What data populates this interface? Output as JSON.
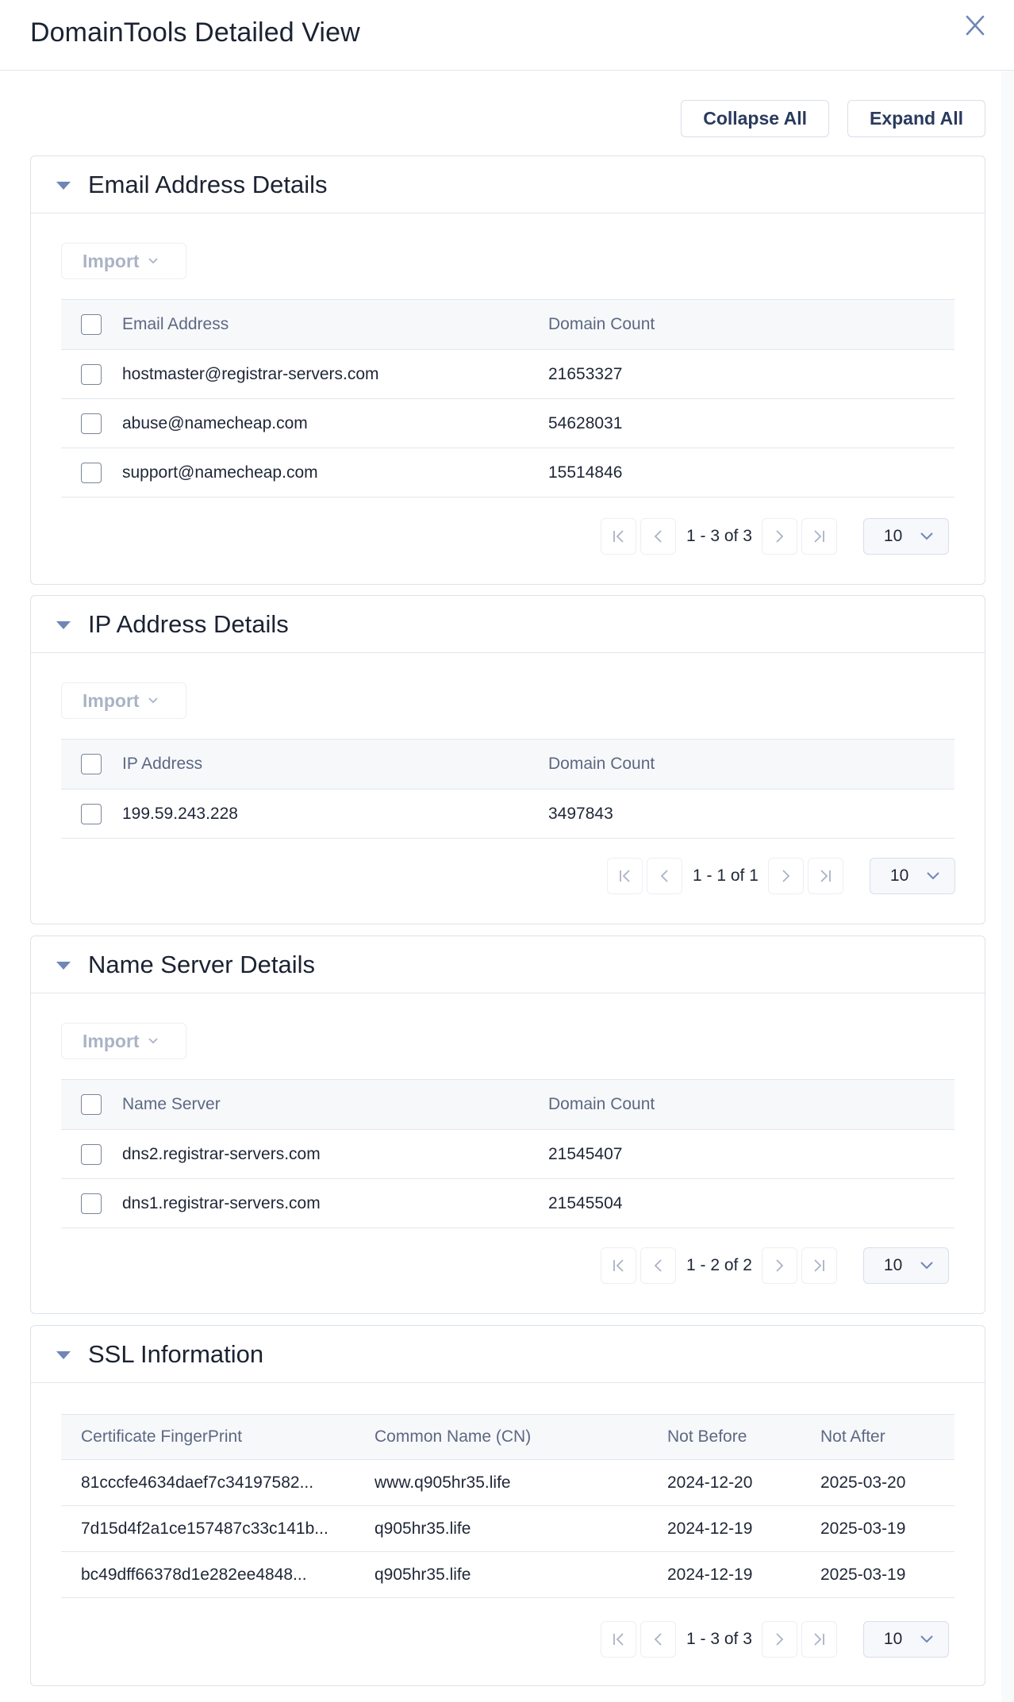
{
  "modal": {
    "title": "DomainTools Detailed View",
    "close_icon": "close-icon"
  },
  "actions": {
    "collapse_all": "Collapse All",
    "expand_all": "Expand All"
  },
  "colors": {
    "accent": "#6f86b6",
    "button_text": "#2a3a5e",
    "text": "#1f2637",
    "muted_header": "#5c6883",
    "disabled_text": "#aab3c5",
    "border": "#e2e6ee"
  },
  "sections": {
    "email": {
      "title": "Email Address Details",
      "import_label": "Import",
      "columns": [
        "Email Address",
        "Domain Count"
      ],
      "rows": [
        {
          "value": "hostmaster@registrar-servers.com",
          "count": "21653327"
        },
        {
          "value": "abuse@namecheap.com",
          "count": "54628031"
        },
        {
          "value": "support@namecheap.com",
          "count": "15514846"
        }
      ],
      "pagination": {
        "info": "1 - 3 of 3",
        "page_size": "10"
      }
    },
    "ip": {
      "title": "IP Address Details",
      "import_label": "Import",
      "columns": [
        "IP Address",
        "Domain Count"
      ],
      "rows": [
        {
          "value": "199.59.243.228",
          "count": "3497843"
        }
      ],
      "pagination": {
        "info": "1 - 1 of 1",
        "page_size": "10"
      }
    },
    "nameserver": {
      "title": "Name Server Details",
      "import_label": "Import",
      "columns": [
        "Name Server",
        "Domain Count"
      ],
      "rows": [
        {
          "value": "dns2.registrar-servers.com",
          "count": "21545407"
        },
        {
          "value": "dns1.registrar-servers.com",
          "count": "21545504"
        }
      ],
      "pagination": {
        "info": "1 - 2 of 2",
        "page_size": "10"
      }
    },
    "ssl": {
      "title": "SSL Information",
      "columns": [
        "Certificate FingerPrint",
        "Common Name (CN)",
        "Not Before",
        "Not After"
      ],
      "rows": [
        {
          "fingerprint": "81cccfe4634daef7c34197582...",
          "cn": "www.q905hr35.life",
          "not_before": "2024-12-20",
          "not_after": "2025-03-20"
        },
        {
          "fingerprint": "7d15d4f2a1ce157487c33c141b...",
          "cn": "q905hr35.life",
          "not_before": "2024-12-19",
          "not_after": "2025-03-19"
        },
        {
          "fingerprint": "bc49dff66378d1e282ee4848...",
          "cn": "q905hr35.life",
          "not_before": "2024-12-19",
          "not_after": "2025-03-19"
        }
      ],
      "pagination": {
        "info": "1 - 3 of 3",
        "page_size": "10"
      }
    }
  }
}
